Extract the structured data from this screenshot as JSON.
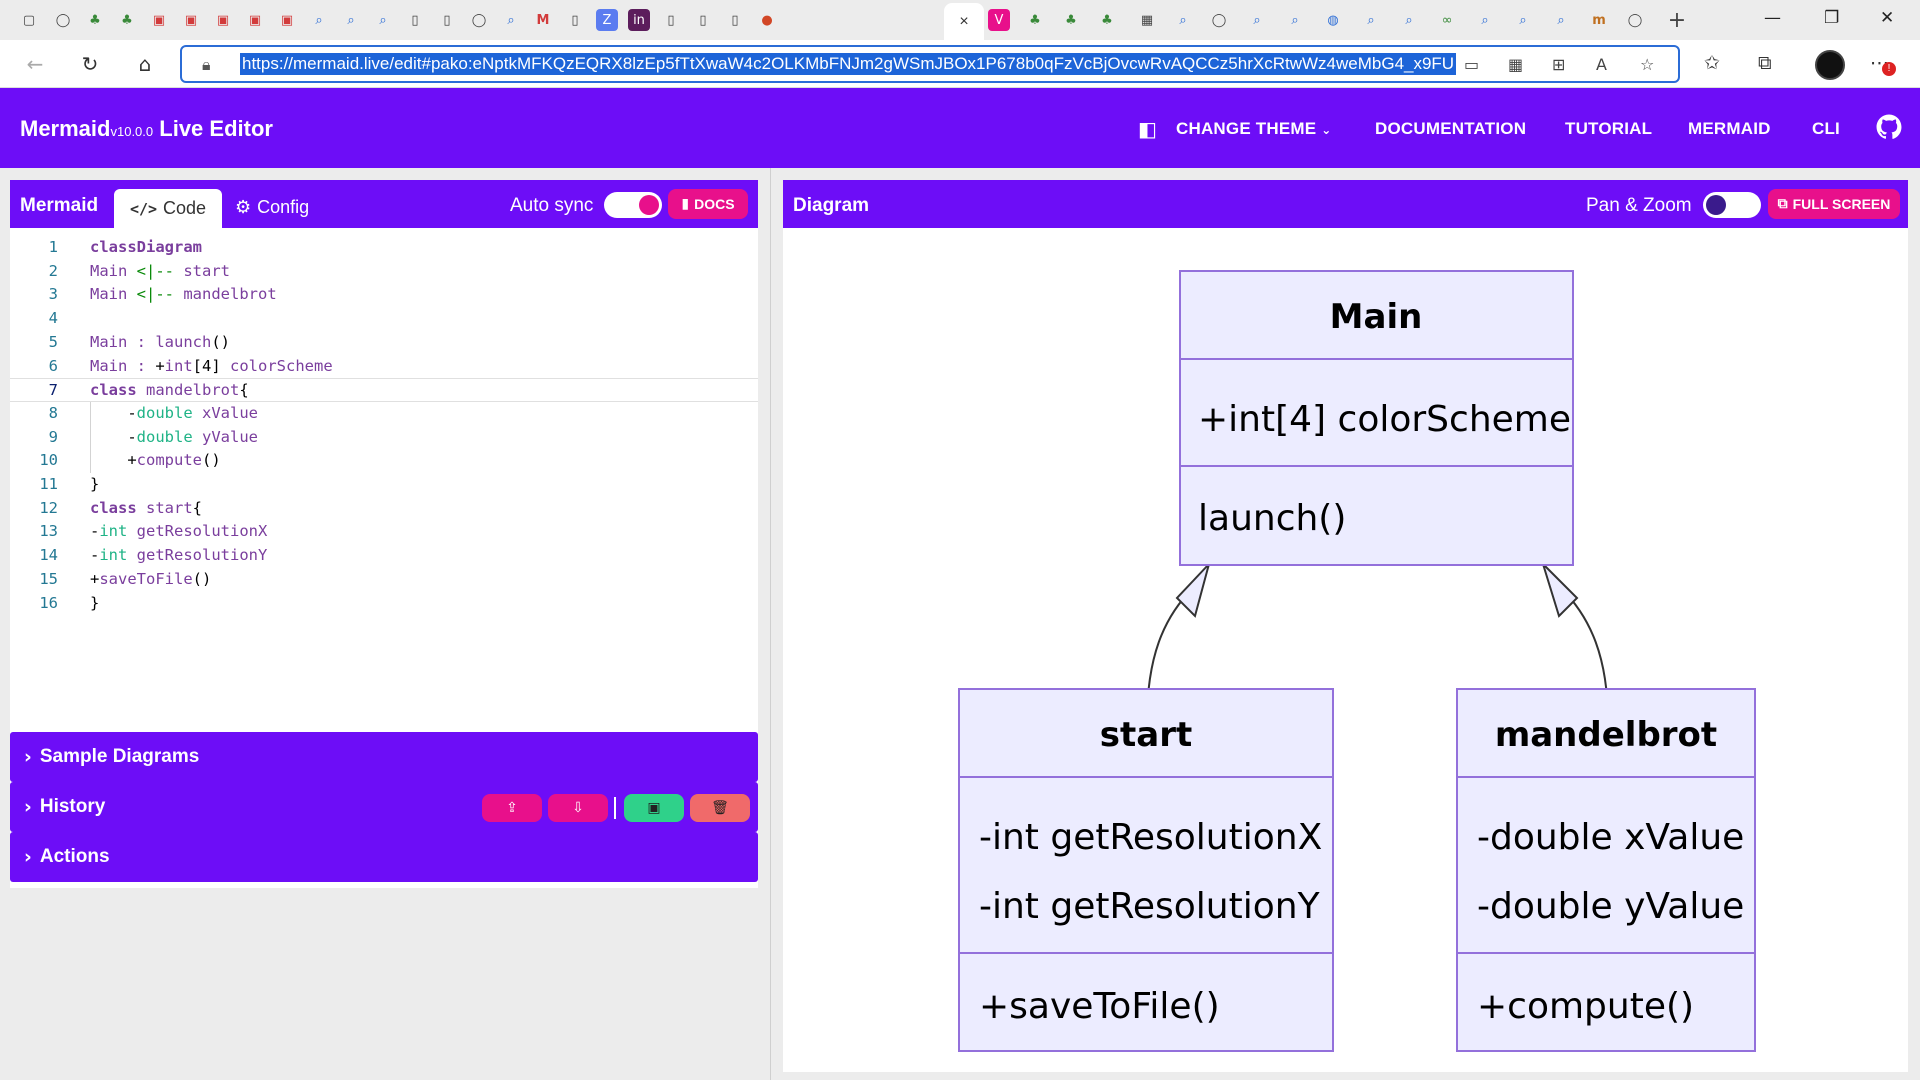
{
  "browser": {
    "url": "https://mermaid.live/edit#pako:eNptkMFKQzEQRX8lzEp5fTtXwaW4c2OLKMbFNJm2gWSmJBOx1P678b0qFzVcBjOvcwRvAQCCz5hrXcRtwWz4weMbG4_x9FU",
    "active_tab_close": "×"
  },
  "header": {
    "brand": "Mermaid",
    "version": "v10.0.0",
    "subtitle": "Live Editor",
    "links": {
      "change_theme": "CHANGE THEME",
      "documentation": "DOCUMENTATION",
      "tutorial": "TUTORIAL",
      "mermaid": "MERMAID",
      "cli": "CLI"
    }
  },
  "editor": {
    "title": "Mermaid",
    "tab_code": "Code",
    "tab_config": "Config",
    "auto_sync_label": "Auto sync",
    "auto_sync_on": true,
    "docs_button": "DOCS",
    "active_line": 7,
    "lines": [
      [
        [
          "kw",
          "classDiagram"
        ]
      ],
      [
        [
          "id",
          "Main "
        ],
        [
          "arrow",
          "<|--"
        ],
        [
          "id",
          " start"
        ]
      ],
      [
        [
          "id",
          "Main "
        ],
        [
          "arrow",
          "<|--"
        ],
        [
          "id",
          " mandelbrot"
        ]
      ],
      [],
      [
        [
          "id",
          "Main : launch"
        ],
        [
          "op",
          "()"
        ]
      ],
      [
        [
          "id",
          "Main : "
        ],
        [
          "op",
          "+"
        ],
        [
          "id",
          "int"
        ],
        [
          "op",
          "[4] "
        ],
        [
          "id",
          "colorScheme"
        ]
      ],
      [
        [
          "kw",
          "class"
        ],
        [
          "id",
          " mandelbrot"
        ],
        [
          "op",
          "{"
        ]
      ],
      [
        [
          "op",
          "    -"
        ],
        [
          "ty",
          "double"
        ],
        [
          "id",
          " xValue"
        ]
      ],
      [
        [
          "op",
          "    -"
        ],
        [
          "ty",
          "double"
        ],
        [
          "id",
          " yValue"
        ]
      ],
      [
        [
          "op",
          "    +"
        ],
        [
          "fn",
          "compute"
        ],
        [
          "op",
          "()"
        ]
      ],
      [
        [
          "op",
          "}"
        ]
      ],
      [
        [
          "kw",
          "class"
        ],
        [
          "id",
          " start"
        ],
        [
          "op",
          "{"
        ]
      ],
      [
        [
          "op",
          "-"
        ],
        [
          "ty",
          "int"
        ],
        [
          "id",
          " getResolutionX"
        ]
      ],
      [
        [
          "op",
          "-"
        ],
        [
          "ty",
          "int"
        ],
        [
          "id",
          " getResolutionY"
        ]
      ],
      [
        [
          "op",
          "+"
        ],
        [
          "fn",
          "saveToFile"
        ],
        [
          "op",
          "()"
        ]
      ],
      [
        [
          "op",
          "}"
        ]
      ]
    ]
  },
  "accordions": {
    "sample_diagrams": "Sample Diagrams",
    "history": "History",
    "actions": "Actions"
  },
  "diagram_panel": {
    "title": "Diagram",
    "pan_zoom_label": "Pan & Zoom",
    "pan_zoom_on": false,
    "full_screen_button": "FULL SCREEN"
  },
  "diagram": {
    "classes": {
      "main": {
        "name": "Main",
        "attributes": [
          "+int[4] colorScheme"
        ],
        "methods": [
          "launch()"
        ]
      },
      "start": {
        "name": "start",
        "attributes": [
          "-int getResolutionX",
          "-int getResolutionY"
        ],
        "methods": [
          "+saveToFile()"
        ]
      },
      "mandelbrot": {
        "name": "mandelbrot",
        "attributes": [
          "-double xValue",
          "-double yValue"
        ],
        "methods": [
          "+compute()"
        ]
      }
    }
  },
  "colors": {
    "brand_purple": "#6d0df7",
    "accent_pink": "#e8108b",
    "save_green": "#2fd18a",
    "delete_red": "#f06a6a",
    "class_fill": "#ececff",
    "class_stroke": "#9370db"
  },
  "icons": {
    "code": "code-icon",
    "config": "gears-icon",
    "docs": "book-icon",
    "full_screen": "external-link-icon",
    "theme": "palette-icon",
    "github": "github-icon",
    "chevron": "chevron-right-icon",
    "upload": "upload-icon",
    "download": "download-icon",
    "save": "save-icon",
    "delete": "trash-icon"
  }
}
